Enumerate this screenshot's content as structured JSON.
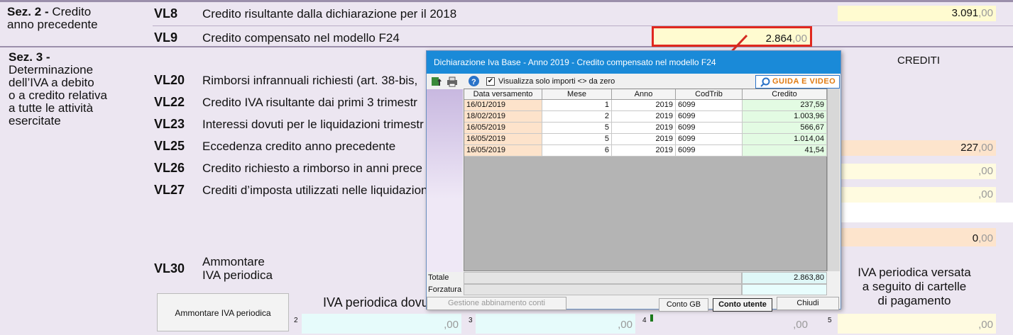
{
  "sections": {
    "sez2": {
      "num": "Sez. 2",
      "title_a": "Credito",
      "title_b": "anno precedente"
    },
    "sez3": {
      "num": "Sez. 3 -",
      "lines": [
        "Determinazione",
        "dell’IVA a debito",
        "o a credito relativa",
        "a tutte le attività",
        "esercitate"
      ]
    }
  },
  "rows": {
    "vl8": {
      "code": "VL8",
      "desc": "Credito risultante dalla dichiarazione per il 2018",
      "int": "3.091",
      "dec": ",00"
    },
    "vl9": {
      "code": "VL9",
      "desc": "Credito compensato nel modello F24",
      "int": "2.864",
      "dec": ",00"
    },
    "vl20": {
      "code": "VL20",
      "desc": "Rimborsi infrannuali richiesti (art. 38-bis,"
    },
    "vl22": {
      "code": "VL22",
      "desc": "Credito IVA risultante dai primi 3 trimestr"
    },
    "vl23": {
      "code": "VL23",
      "desc": "Interessi dovuti per le liquidazioni trimestr"
    },
    "vl25": {
      "code": "VL25",
      "desc": "Eccedenza credito anno precedente",
      "int": "227",
      "dec": ",00"
    },
    "vl26": {
      "code": "VL26",
      "desc": "Credito richiesto a rimborso in anni prece",
      "dec": ",00"
    },
    "vl27": {
      "code": "VL27",
      "desc": "Crediti d’imposta utilizzati nelle liquidazioni",
      "dec": ",00"
    },
    "blank_dec": ",00",
    "zero_val": {
      "int": "0",
      "dec": ",00"
    },
    "vl30": {
      "code": "VL30",
      "desc_a": "Ammontare",
      "desc_b": "IVA periodica"
    }
  },
  "crediti_header": "CREDITI",
  "iva_versata": [
    "IVA periodica versata",
    "a seguito di cartelle",
    "di pagamento"
  ],
  "iva_dovuta": "IVA periodica dovu",
  "ammontare_button": "Ammontare IVA periodica",
  "bottom_fields": [
    {
      "num": "2",
      "dec": ",00"
    },
    {
      "num": "3",
      "dec": ",00"
    },
    {
      "num": "4",
      "dec": ",00"
    },
    {
      "num": "5",
      "dec": ",00"
    }
  ],
  "dialog": {
    "title": "Dichiarazione Iva Base - Anno 2019 - Credito compensato nel modello F24",
    "checkbox_label": "Visualizza solo importi <> da zero",
    "guide_button": "GUIDA E VIDEO",
    "columns": [
      "Data versamento",
      "Mese",
      "Anno",
      "CodTrib",
      "Credito"
    ],
    "rows": [
      [
        "16/01/2019",
        "1",
        "2019",
        "6099",
        "237,59"
      ],
      [
        "18/02/2019",
        "2",
        "2019",
        "6099",
        "1.003,96"
      ],
      [
        "16/05/2019",
        "5",
        "2019",
        "6099",
        "566,67"
      ],
      [
        "16/05/2019",
        "5",
        "2019",
        "6099",
        "1.014,04"
      ],
      [
        "16/05/2019",
        "6",
        "2019",
        "6099",
        "41,54"
      ]
    ],
    "totale_label": "Totale",
    "totale_value": "2.863,80",
    "forzatura_label": "Forzatura",
    "buttons": {
      "gestione": "Gestione abbinamento conti",
      "conto_gb": "Conto GB",
      "conto_utente": "Conto utente",
      "chiudi": "Chiudi"
    }
  },
  "colors": {
    "highlight_box": "#e0281f",
    "arrow": "#d42a20",
    "dialog_title_bg": "#1a8ad8"
  }
}
